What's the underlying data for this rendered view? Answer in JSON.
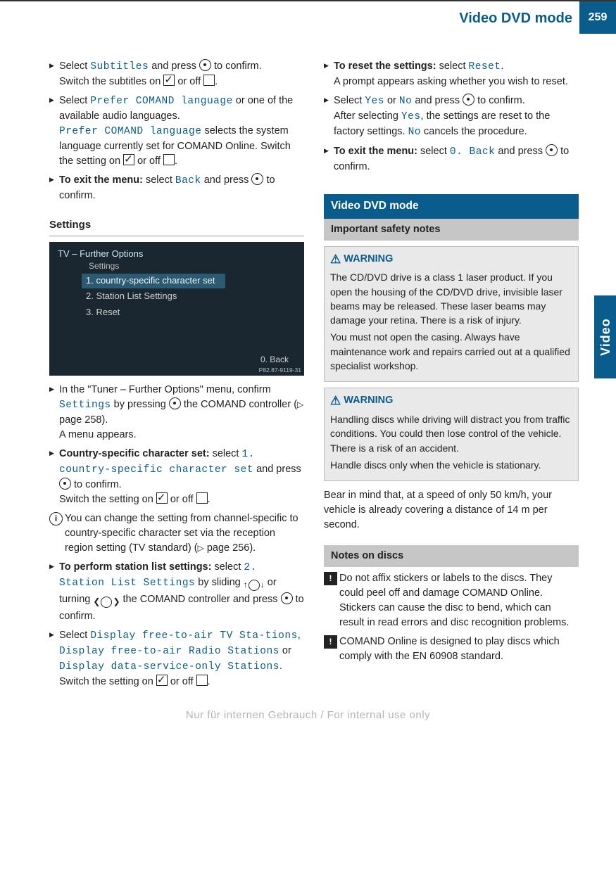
{
  "header": {
    "title": "Video DVD mode",
    "page_number": "259"
  },
  "side_tab": "Video",
  "left": {
    "step1": {
      "pre": "Select ",
      "mono": "Subtitles",
      "post1": " and press ",
      "post2": " to confirm.",
      "line2a": "Switch the subtitles on ",
      "line2b": " or off ",
      "line2c": "."
    },
    "step2": {
      "pre": "Select ",
      "mono1": "Prefer COMAND language",
      "post1": " or one of the available audio languages.",
      "mono2": "Prefer COMAND language",
      "post2": " selects the system language currently set for COMAND Online. Switch the setting on ",
      "post3": " or off ",
      "post4": "."
    },
    "step3": {
      "bold": "To exit the menu:",
      "post1": " select ",
      "mono": "Back",
      "post2": " and press ",
      "post3": " to confirm."
    },
    "settings_h": "Settings",
    "figure": {
      "title": "TV – Further Options",
      "subtitle": "Settings",
      "rows": [
        "1. country-specific character set",
        "2. Station List Settings",
        "3. Reset"
      ],
      "back": "0. Back",
      "code": "P82.87-9119-31"
    },
    "step4": {
      "pre": "In the \"Tuner – Further Options\" menu, confirm ",
      "mono": "Settings",
      "post1": " by pressing ",
      "post2": " the COMAND controller (",
      "page_ref": "page 258",
      "post3": ").",
      "line3": "A menu appears."
    },
    "step5": {
      "bold": "Country-specific character set:",
      "post1": " select ",
      "mono": "1. country-specific character set",
      "post2": " and press ",
      "post3": " to confirm.",
      "line3a": "Switch the setting on ",
      "line3b": " or off ",
      "line3c": "."
    },
    "info1": "You can change the setting from channel-specific to country-specific character set via the reception region setting (TV standard) (",
    "info1_page": "page 256",
    "info1_end": ").",
    "step6": {
      "bold": "To perform station list settings:",
      "post1": " select ",
      "mono": "2. Station List Settings",
      "post2": " by sliding ",
      "post3": " or turning ",
      "post4": " the COMAND controller and press ",
      "post5": " to confirm."
    },
    "step7": {
      "pre": "Select ",
      "mono1": "Display free-to-air TV Sta‐tions",
      "sep1": ", ",
      "mono2": "Display free-to-air Radio Stations",
      "sep2": " or ",
      "mono3": "Display data-service-only Stations",
      "end": ".",
      "line2a": "Switch the setting on ",
      "line2b": " or off ",
      "line2c": "."
    }
  },
  "right": {
    "step8": {
      "bold": "To reset the settings:",
      "post1": " select ",
      "mono": "Reset",
      "end": ".",
      "line2": "A prompt appears asking whether you wish to reset."
    },
    "step9": {
      "pre": "Select ",
      "mono1": "Yes",
      "sep1": " or ",
      "mono2": "No",
      "post1": " and press ",
      "post2": " to confirm.",
      "line2a": "After selecting ",
      "mono3": "Yes",
      "line2b": ", the settings are reset to the factory settings. ",
      "mono4": "No",
      "line2c": " cancels the procedure."
    },
    "step10": {
      "bold": "To exit the menu:",
      "post1": " select ",
      "mono": "0. Back",
      "post2": " and press ",
      "post3": " to confirm."
    },
    "section_title": "Video DVD mode",
    "subsection1": "Important safety notes",
    "warning_label": "WARNING",
    "warning1a": "The CD/DVD drive is a class 1 laser product. If you open the housing of the CD/DVD drive, invisible laser beams may be released. These laser beams may damage your retina. There is a risk of injury.",
    "warning1b": "You must not open the casing. Always have maintenance work and repairs carried out at a qualified specialist workshop.",
    "warning2a": "Handling discs while driving will distract you from traffic conditions. You could then lose control of the vehicle. There is a risk of an accident.",
    "warning2b": "Handle discs only when the vehicle is stationary.",
    "para_after": "Bear in mind that, at a speed of only 50 km/h, your vehicle is already covering a distance of 14 m per second.",
    "subsection2": "Notes on discs",
    "note1": "Do not affix stickers or labels to the discs. They could peel off and damage COMAND Online. Stickers can cause the disc to bend, which can result in read errors and disc recognition problems.",
    "note2": "COMAND Online is designed to play discs which comply with the EN 60908 standard."
  },
  "watermark": "Nur für internen Gebrauch / For internal use only"
}
